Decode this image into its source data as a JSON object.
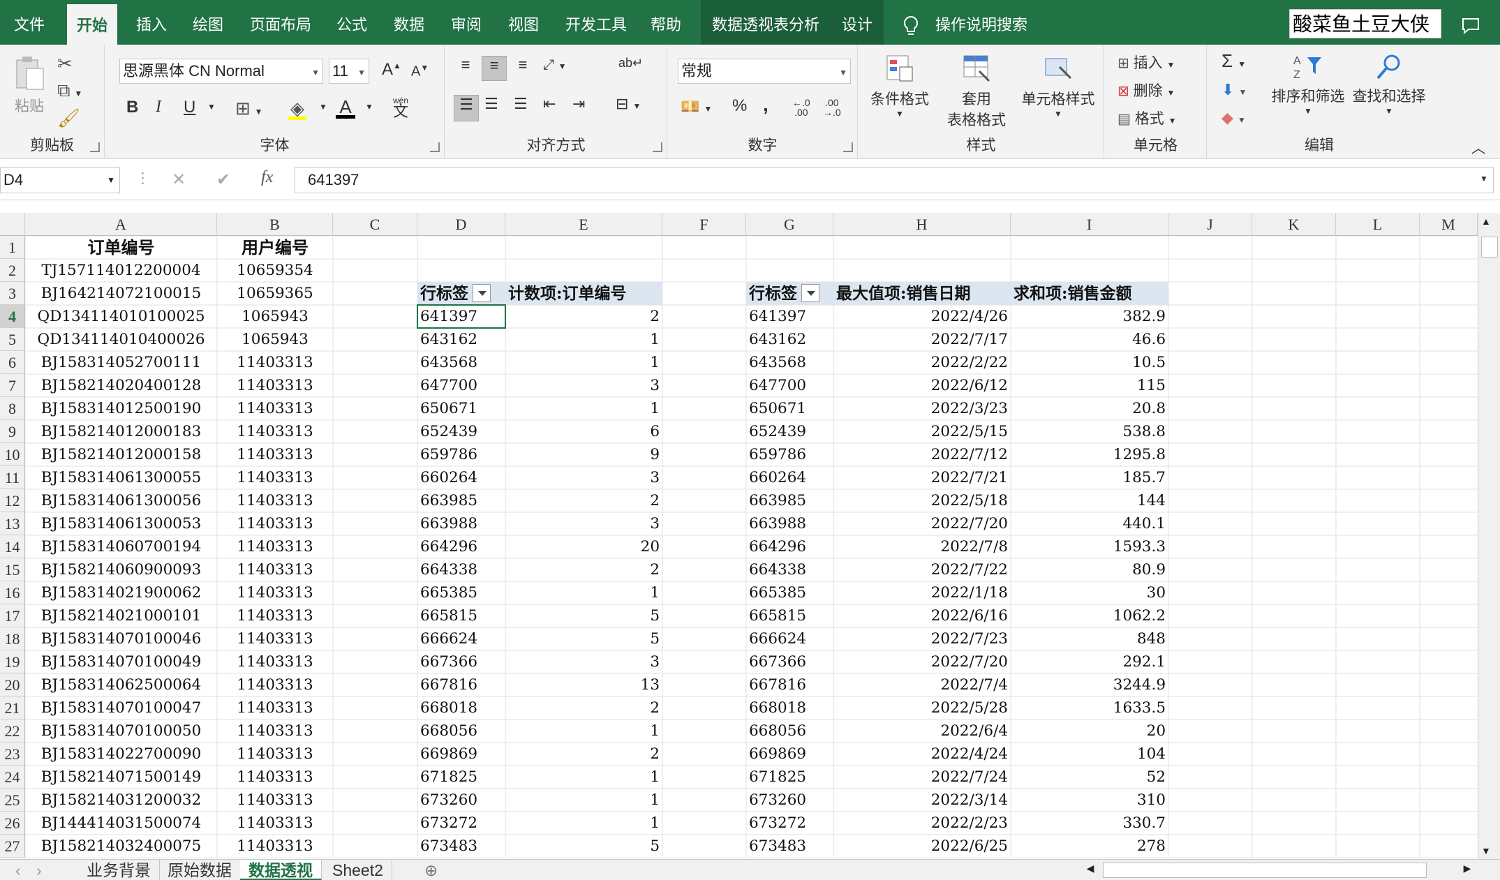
{
  "ribbon_tabs": [
    "文件",
    "开始",
    "插入",
    "绘图",
    "页面布局",
    "公式",
    "数据",
    "审阅",
    "视图",
    "开发工具",
    "帮助",
    "数据透视表分析",
    "设计"
  ],
  "active_tab": "开始",
  "search_hint": "操作说明搜索",
  "user_name": "酸菜鱼土豆大侠",
  "clipboard": {
    "paste": "粘贴",
    "label": "剪贴板"
  },
  "font": {
    "name": "思源黑体 CN Normal",
    "size": "11",
    "bold": "B",
    "italic": "I",
    "underline": "U",
    "label": "字体",
    "phonetic_top": "wén",
    "phonetic_bottom": "文"
  },
  "alignment": {
    "label": "对齐方式"
  },
  "number": {
    "format": "常规",
    "percent": "%",
    "comma": ",",
    "label": "数字"
  },
  "styles": {
    "conditional": "条件格式",
    "table_line1": "套用",
    "table_line2": "表格格式",
    "cell_styles": "单元格样式",
    "label": "样式"
  },
  "cells": {
    "insert": "插入",
    "delete": "删除",
    "format": "格式",
    "label": "单元格"
  },
  "editing": {
    "sort": "排序和筛选",
    "find": "查找和选择",
    "label": "编辑"
  },
  "name_box": "D4",
  "formula_value": "641397",
  "columns": [
    "A",
    "B",
    "C",
    "D",
    "E",
    "F",
    "G",
    "H",
    "I",
    "J",
    "K",
    "L",
    "M"
  ],
  "headers": {
    "a1": "订单编号",
    "b1": "用户编号"
  },
  "pivot1": {
    "row_label": "行标签",
    "value_label": "计数项:订单编号"
  },
  "pivot2": {
    "row_label": "行标签",
    "max_label": "最大值项:销售日期",
    "sum_label": "求和项:销售金额"
  },
  "rows": [
    {
      "a": "TJ157114012200004",
      "b": "10659354"
    },
    {
      "a": "BJ164214072100015",
      "b": "10659365"
    },
    {
      "a": "QD134114010100025",
      "b": "1065943",
      "d": "641397",
      "e": "2",
      "h": "2022/4/26",
      "i": "382.9"
    },
    {
      "a": "QD134114010400026",
      "b": "1065943",
      "d": "643162",
      "e": "1",
      "h": "2022/7/17",
      "i": "46.6"
    },
    {
      "a": "BJ158314052700111",
      "b": "11403313",
      "d": "643568",
      "e": "1",
      "h": "2022/2/22",
      "i": "10.5"
    },
    {
      "a": "BJ158214020400128",
      "b": "11403313",
      "d": "647700",
      "e": "3",
      "h": "2022/6/12",
      "i": "115"
    },
    {
      "a": "BJ158314012500190",
      "b": "11403313",
      "d": "650671",
      "e": "1",
      "h": "2022/3/23",
      "i": "20.8"
    },
    {
      "a": "BJ158214012000183",
      "b": "11403313",
      "d": "652439",
      "e": "6",
      "h": "2022/5/15",
      "i": "538.8"
    },
    {
      "a": "BJ158214012000158",
      "b": "11403313",
      "d": "659786",
      "e": "9",
      "h": "2022/7/12",
      "i": "1295.8"
    },
    {
      "a": "BJ158314061300055",
      "b": "11403313",
      "d": "660264",
      "e": "3",
      "h": "2022/7/21",
      "i": "185.7"
    },
    {
      "a": "BJ158314061300056",
      "b": "11403313",
      "d": "663985",
      "e": "2",
      "h": "2022/5/18",
      "i": "144"
    },
    {
      "a": "BJ158314061300053",
      "b": "11403313",
      "d": "663988",
      "e": "3",
      "h": "2022/7/20",
      "i": "440.1"
    },
    {
      "a": "BJ158314060700194",
      "b": "11403313",
      "d": "664296",
      "e": "20",
      "h": "2022/7/8",
      "i": "1593.3"
    },
    {
      "a": "BJ158214060900093",
      "b": "11403313",
      "d": "664338",
      "e": "2",
      "h": "2022/7/22",
      "i": "80.9"
    },
    {
      "a": "BJ158314021900062",
      "b": "11403313",
      "d": "665385",
      "e": "1",
      "h": "2022/1/18",
      "i": "30"
    },
    {
      "a": "BJ158214021000101",
      "b": "11403313",
      "d": "665815",
      "e": "5",
      "h": "2022/6/16",
      "i": "1062.2"
    },
    {
      "a": "BJ158314070100046",
      "b": "11403313",
      "d": "666624",
      "e": "5",
      "h": "2022/7/23",
      "i": "848"
    },
    {
      "a": "BJ158314070100049",
      "b": "11403313",
      "d": "667366",
      "e": "3",
      "h": "2022/7/20",
      "i": "292.1"
    },
    {
      "a": "BJ158314062500064",
      "b": "11403313",
      "d": "667816",
      "e": "13",
      "h": "2022/7/4",
      "i": "3244.9"
    },
    {
      "a": "BJ158314070100047",
      "b": "11403313",
      "d": "668018",
      "e": "2",
      "h": "2022/5/28",
      "i": "1633.5"
    },
    {
      "a": "BJ158314070100050",
      "b": "11403313",
      "d": "668056",
      "e": "1",
      "h": "2022/6/4",
      "i": "20"
    },
    {
      "a": "BJ158314022700090",
      "b": "11403313",
      "d": "669869",
      "e": "2",
      "h": "2022/4/24",
      "i": "104"
    },
    {
      "a": "BJ158214071500149",
      "b": "11403313",
      "d": "671825",
      "e": "1",
      "h": "2022/7/24",
      "i": "52"
    },
    {
      "a": "BJ158214031200032",
      "b": "11403313",
      "d": "673260",
      "e": "1",
      "h": "2022/3/14",
      "i": "310"
    },
    {
      "a": "BJ144414031500074",
      "b": "11403313",
      "d": "673272",
      "e": "1",
      "h": "2022/2/23",
      "i": "330.7"
    },
    {
      "a": "BJ158214032400075",
      "b": "11403313",
      "d": "673483",
      "e": "5",
      "h": "2022/6/25",
      "i": "278"
    }
  ],
  "sheet_tabs": [
    "业务背景",
    "原始数据",
    "数据透视",
    "Sheet2"
  ],
  "active_sheet": "数据透视",
  "colors": {
    "excel_green": "#217346",
    "pivot_header": "#dce6f1"
  }
}
